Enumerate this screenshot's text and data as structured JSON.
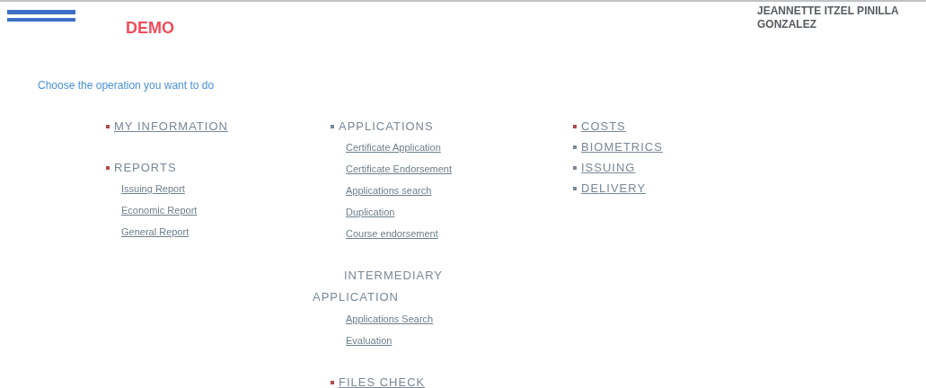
{
  "header": {
    "badge": "DEMO",
    "user_name": "JEANNETTE ITZEL PINILLA GONZALEZ"
  },
  "prompt": "Choose the operation you want to do",
  "columns": [
    [
      {
        "kind": "link",
        "label": "MY INFORMATION",
        "color": "#b04a4a"
      },
      {
        "kind": "heading",
        "label": "REPORTS",
        "color": "#b04a4a",
        "children": [
          {
            "label": "Issuing Report"
          },
          {
            "label": "Economic Report"
          },
          {
            "label": "General Report"
          }
        ]
      }
    ],
    [
      {
        "kind": "heading",
        "label": "APPLICATIONS",
        "color": "#7a8896",
        "children": [
          {
            "label": "Certificate Application"
          },
          {
            "label": "Certificate Endorsement"
          },
          {
            "label": "Applications search"
          },
          {
            "label": "Duplication"
          },
          {
            "label": "Course endorsement"
          }
        ]
      },
      {
        "kind": "plain",
        "label": "INTERMEDIARY APPLICATION",
        "children": [
          {
            "label": "Applications Search"
          },
          {
            "label": "Evaluation"
          }
        ]
      },
      {
        "kind": "link",
        "label": "FILES CHECK",
        "color": "#b04a4a"
      }
    ],
    [
      {
        "kind": "link",
        "label": "COSTS",
        "color": "#b04a4a"
      },
      {
        "kind": "link",
        "label": "BIOMETRICS",
        "color": "#7a8896"
      },
      {
        "kind": "link",
        "label": "ISSUING",
        "color": "#7a8896"
      },
      {
        "kind": "link",
        "label": "DELIVERY",
        "color": "#7a8896"
      }
    ]
  ]
}
